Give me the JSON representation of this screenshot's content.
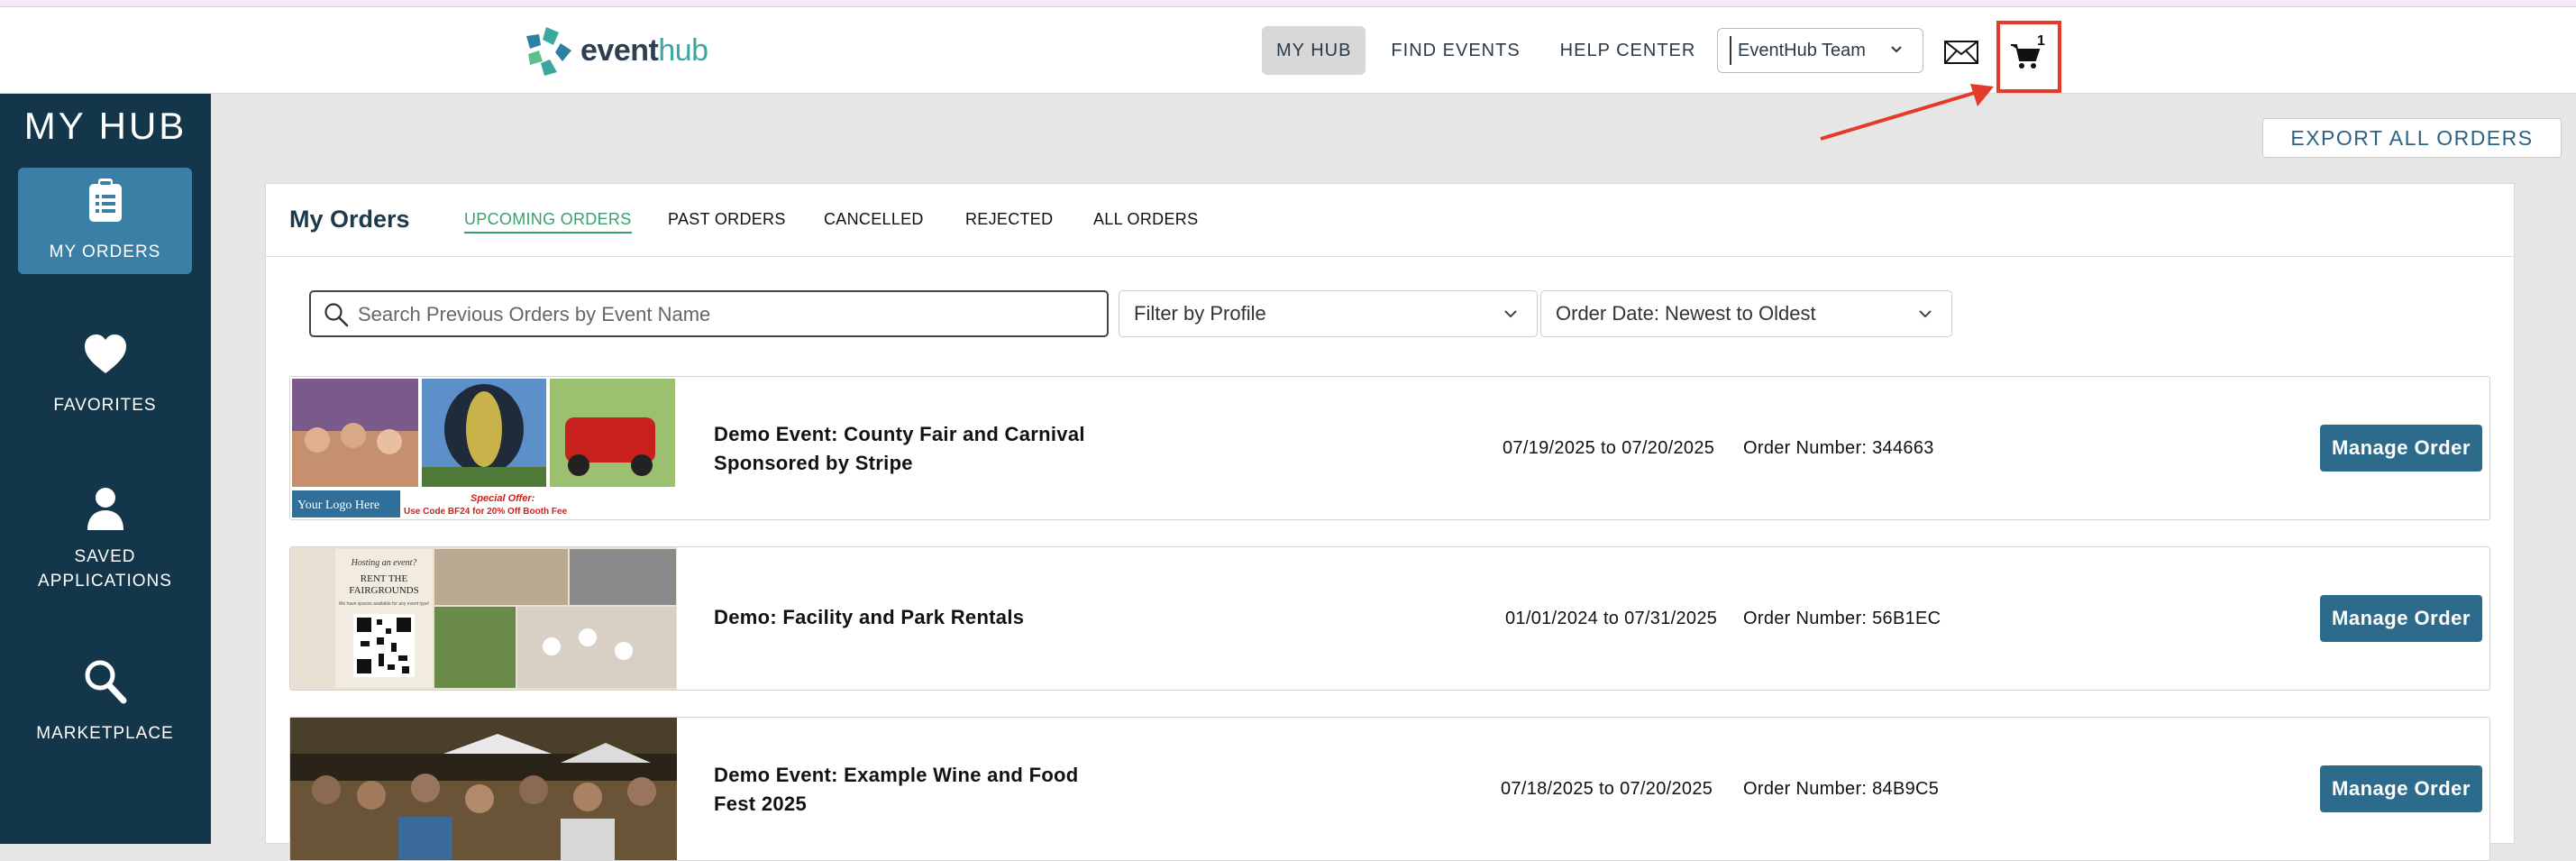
{
  "brand": {
    "name_a": "event",
    "name_b": "hub"
  },
  "nav": {
    "items": [
      {
        "label": "MY HUB",
        "active": true
      },
      {
        "label": "FIND EVENTS",
        "active": false
      },
      {
        "label": "HELP CENTER",
        "active": false
      }
    ],
    "team_select": "EventHub Team",
    "cart_count": "1"
  },
  "sidebar": {
    "title": "MY HUB",
    "items": [
      {
        "label": "MY ORDERS",
        "icon": "clipboard-icon",
        "active": true
      },
      {
        "label": "FAVORITES",
        "icon": "heart-icon",
        "active": false
      },
      {
        "label": "SAVED APPLICATIONS",
        "icon": "user-icon",
        "active": false
      },
      {
        "label": "MARKETPLACE",
        "icon": "search-icon",
        "active": false
      }
    ]
  },
  "export_label": "EXPORT ALL ORDERS",
  "orders_panel": {
    "title": "My Orders",
    "tabs": [
      "UPCOMING ORDERS",
      "PAST ORDERS",
      "CANCELLED",
      "REJECTED",
      "ALL ORDERS"
    ],
    "search_placeholder": "Search Previous Orders by Event Name",
    "filter_profile": "Filter by Profile",
    "sort_order": "Order Date: Newest to Oldest"
  },
  "orders": [
    {
      "name_line1": "Demo Event: County Fair and Carnival",
      "name_line2": "Sponsored by Stripe",
      "dates": "07/19/2025 to 07/20/2025",
      "order_number": "Order Number: 344663",
      "button": "Manage Order",
      "banner": {
        "logo_text": "Your Logo Here",
        "offer_title": "Special Offer:",
        "offer_text": "Use Code BF24 for 20% Off Booth Fee"
      }
    },
    {
      "name_line1": "Demo: Facility and Park Rentals",
      "name_line2": "",
      "dates": "01/01/2024 to 07/31/2025",
      "order_number": "Order Number: 56B1EC",
      "button": "Manage Order",
      "banner": {
        "line1": "Hosting an event?",
        "line2": "RENT THE",
        "line3": "FAIRGROUNDS",
        "line4": "We have spaces available for any event type!"
      }
    },
    {
      "name_line1": "Demo Event: Example Wine and Food",
      "name_line2": "Fest 2025",
      "dates": "07/18/2025 to 07/20/2025",
      "order_number": "Order Number: 84B9C5",
      "button": "Manage Order"
    }
  ],
  "colors": {
    "sidebar": "#14364a",
    "sidebar_active": "#3a7fa6",
    "button": "#2c6b8c",
    "tab_active": "#3aa06b",
    "highlight": "#e53a2a"
  }
}
